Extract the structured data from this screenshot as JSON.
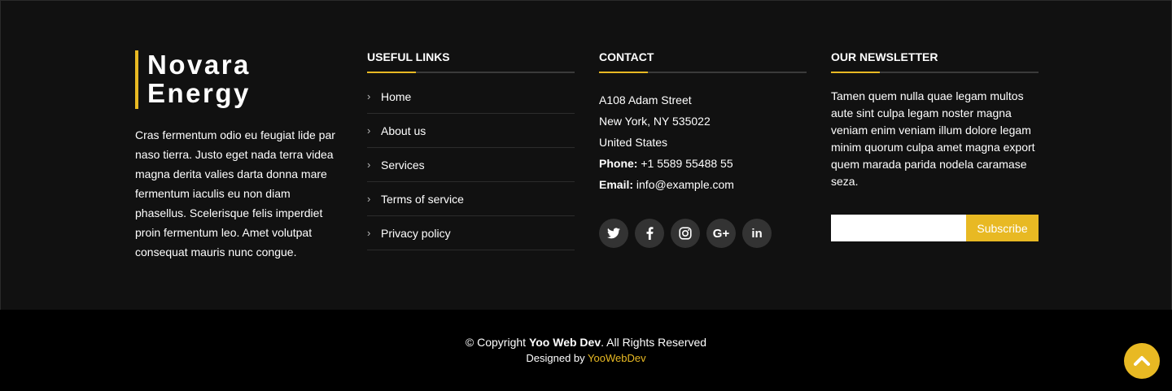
{
  "brand": {
    "line1": "Novara",
    "line2": "Energy",
    "description": "Cras fermentum odio eu feugiat lide par naso tierra. Justo eget nada terra videa magna derita valies darta donna mare fermentum iaculis eu non diam phasellus. Scelerisque felis imperdiet proin fermentum leo. Amet volutpat consequat mauris nunc congue."
  },
  "links": {
    "heading": "USEFUL LINKS",
    "items": [
      "Home",
      "About us",
      "Services",
      "Terms of service",
      "Privacy policy"
    ]
  },
  "contact": {
    "heading": "CONTACT",
    "street": "A108 Adam Street",
    "city": "New York, NY 535022",
    "country": "United States",
    "phone_label": "Phone:",
    "phone": "+1 5589 55488 55",
    "email_label": "Email:",
    "email": "info@example.com",
    "socials": [
      "twitter-icon",
      "facebook-icon",
      "instagram-icon",
      "google-plus-icon",
      "linkedin-icon"
    ]
  },
  "newsletter": {
    "heading": "OUR NEWSLETTER",
    "text": "Tamen quem nulla quae legam multos aute sint culpa legam noster magna veniam enim veniam illum dolore legam minim quorum culpa amet magna export quem marada parida nodela caramase seza.",
    "input_value": "",
    "button_label": "Subscribe"
  },
  "footer": {
    "copyright_prefix": "© Copyright",
    "company": "Yoo Web Dev",
    "copyright_suffix": ". All Rights Reserved",
    "designed_by": "Designed by",
    "designer": "YooWebDev"
  },
  "colors": {
    "accent": "#e8b923",
    "background_top": "#111111",
    "background_bottom": "#000000"
  }
}
